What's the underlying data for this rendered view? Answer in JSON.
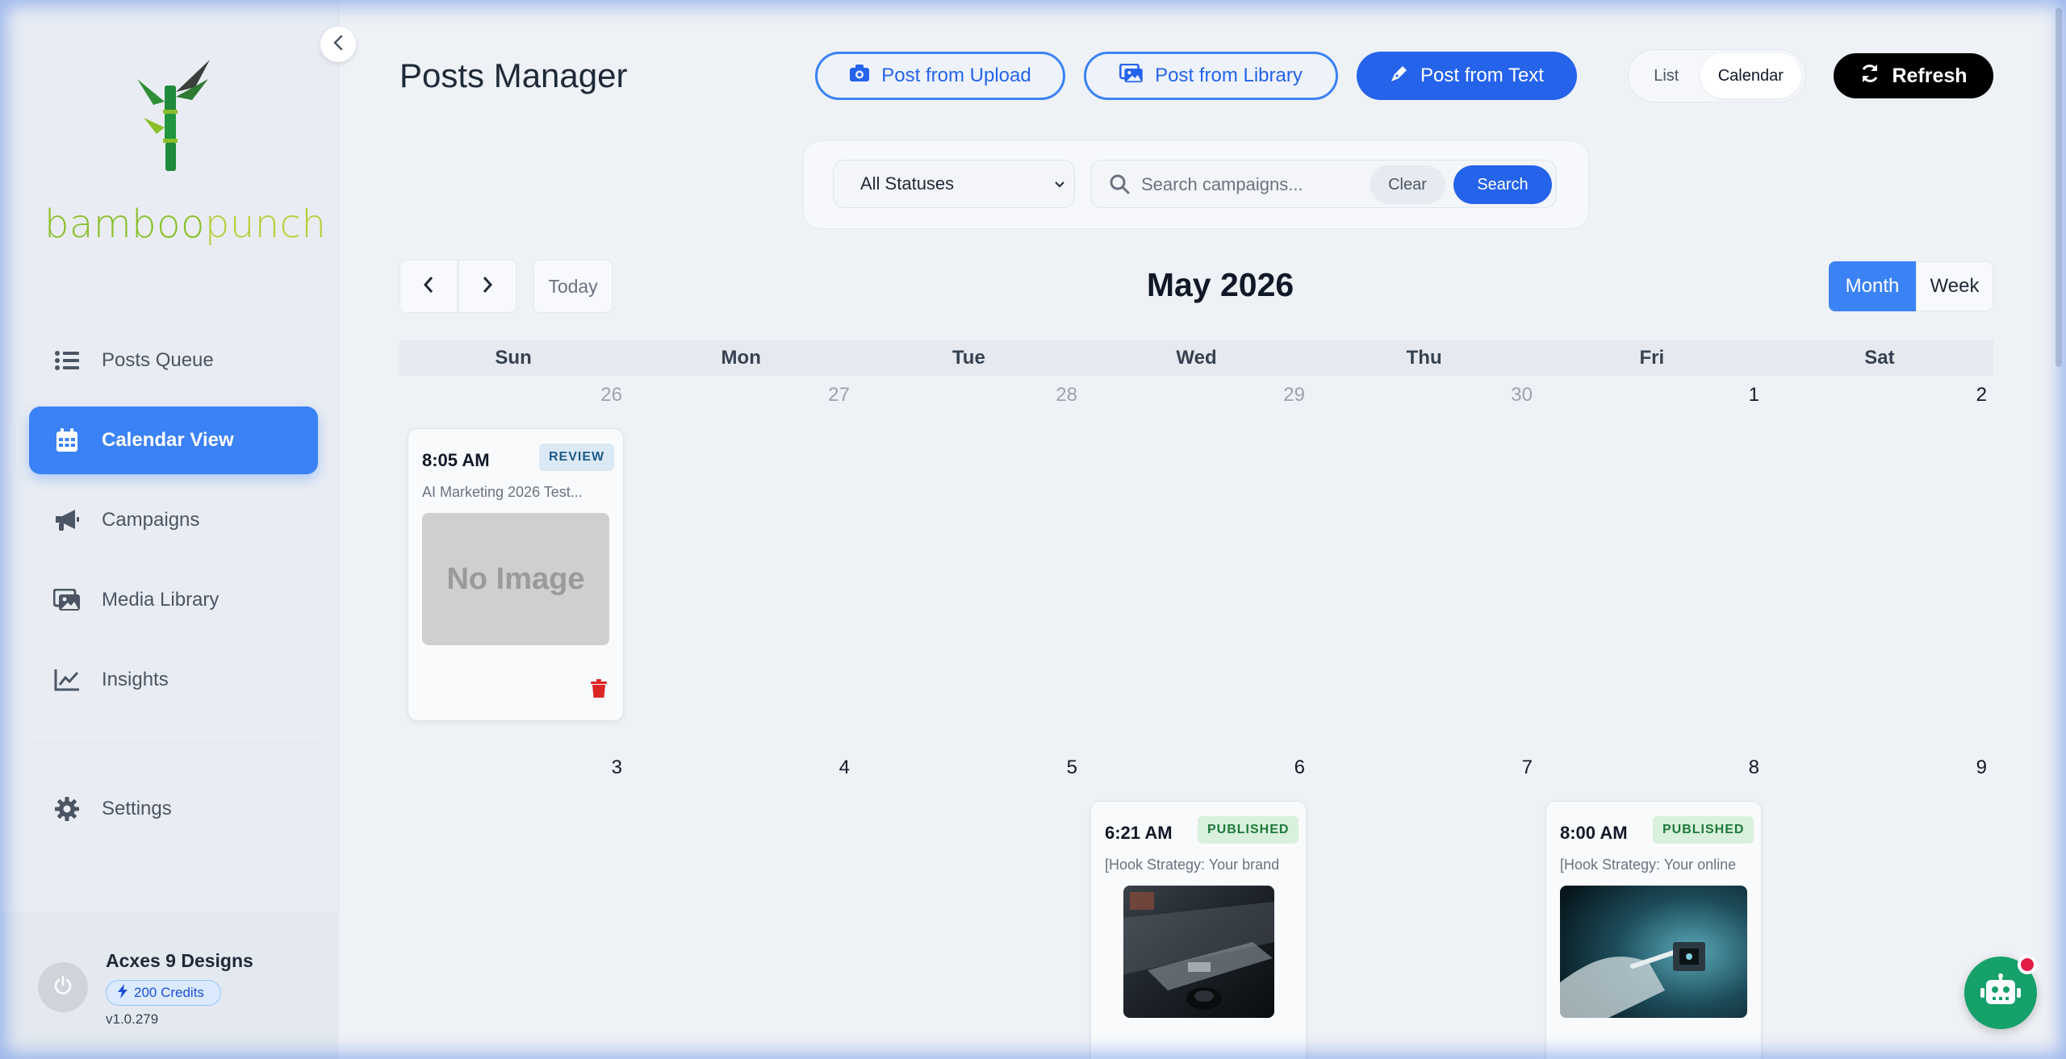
{
  "sidebar": {
    "brand": {
      "part1": "bamboo",
      "part2": "punch"
    },
    "items": [
      {
        "label": "Posts Queue",
        "icon": "list-icon"
      },
      {
        "label": "Calendar View",
        "icon": "calendar-icon"
      },
      {
        "label": "Campaigns",
        "icon": "megaphone-icon"
      },
      {
        "label": "Media Library",
        "icon": "images-icon"
      },
      {
        "label": "Insights",
        "icon": "chart-line-icon"
      },
      {
        "label": "Settings",
        "icon": "gear-icon"
      }
    ],
    "active_item": "Calendar View",
    "user": {
      "name": "Acxes 9 Designs",
      "credits": "200 Credits",
      "version": "v1.0.279"
    }
  },
  "header": {
    "title": "Posts Manager",
    "buttons": {
      "upload": "Post from Upload",
      "library": "Post from Library",
      "text": "Post from Text",
      "refresh": "Refresh"
    },
    "view_toggle": {
      "list": "List",
      "calendar": "Calendar",
      "selected": "Calendar"
    }
  },
  "filters": {
    "status_value": "All Statuses",
    "search_placeholder": "Search campaigns...",
    "clear_label": "Clear",
    "search_label": "Search"
  },
  "calendar": {
    "today_label": "Today",
    "month_title": "May 2026",
    "mode": {
      "month": "Month",
      "week": "Week",
      "selected": "Month"
    },
    "days_of_week": [
      "Sun",
      "Mon",
      "Tue",
      "Wed",
      "Thu",
      "Fri",
      "Sat"
    ],
    "week1": [
      "26",
      "27",
      "28",
      "29",
      "30",
      "1",
      "2"
    ],
    "week2": [
      "3",
      "4",
      "5",
      "6",
      "7",
      "8",
      "9"
    ],
    "posts": [
      {
        "day": "26",
        "time": "8:05 AM",
        "status": "REVIEW",
        "caption": "AI Marketing 2026 Test...",
        "image": "No Image"
      },
      {
        "day": "6",
        "time": "6:21 AM",
        "status": "PUBLISHED",
        "caption": "[Hook Strategy: Your brand"
      },
      {
        "day": "8",
        "time": "8:00 AM",
        "status": "PUBLISHED",
        "caption": "[Hook Strategy: Your online"
      }
    ]
  },
  "colors": {
    "accent": "#3b82f6",
    "primary": "#2563eb",
    "review_badge": "#dbe9f5",
    "published_badge": "#d8f0dc",
    "chat": "#16a06a"
  }
}
